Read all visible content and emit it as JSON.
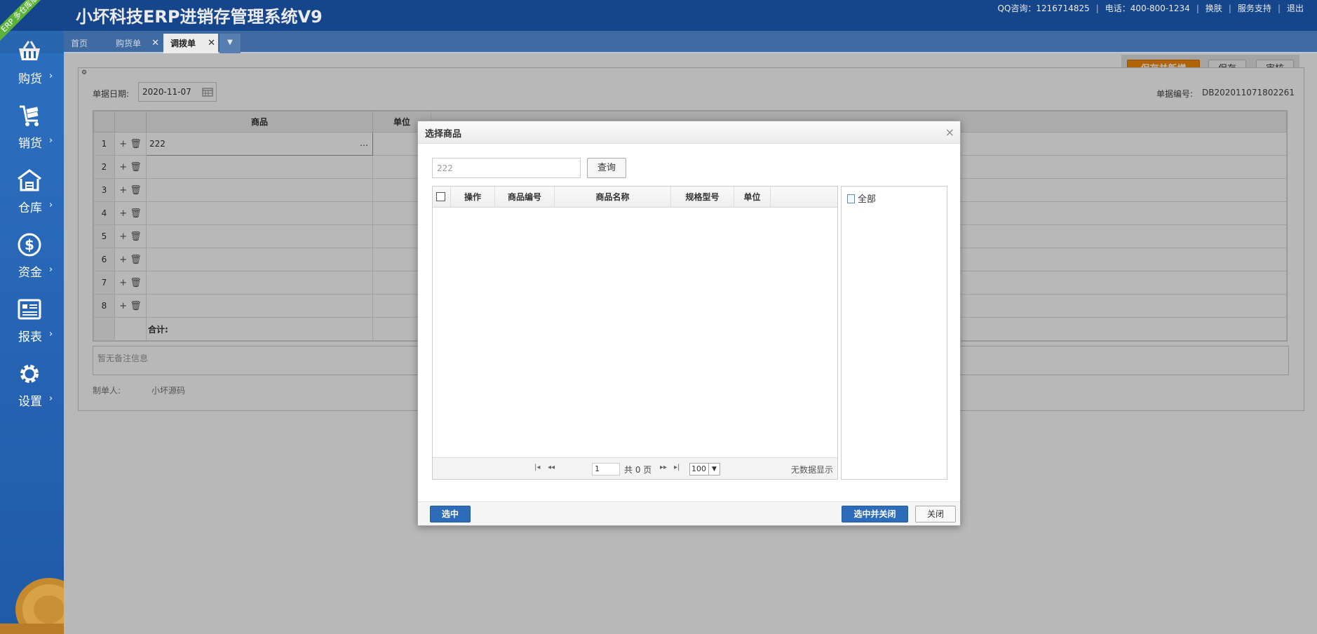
{
  "header": {
    "title": "小坏科技ERP进销存管理系统V9",
    "ribbon": "ERP 多仓库版",
    "links": [
      "QQ咨询：1216714825",
      "电话：400-800-1234",
      "换肤",
      "服务支持",
      "退出"
    ]
  },
  "sidebar": {
    "items": [
      {
        "label": "购货",
        "icon": "basket-icon"
      },
      {
        "label": "销货",
        "icon": "cart-icon"
      },
      {
        "label": "仓库",
        "icon": "warehouse-icon"
      },
      {
        "label": "资金",
        "icon": "dollar-icon"
      },
      {
        "label": "报表",
        "icon": "report-icon"
      },
      {
        "label": "设置",
        "icon": "gear-icon"
      }
    ]
  },
  "tabs": [
    {
      "label": "首页"
    },
    {
      "label": "购货单"
    },
    {
      "label": "调拨单"
    }
  ],
  "form": {
    "date_label": "单据日期:",
    "date_value": "2020-11-07",
    "doc_no_label": "单据编号:",
    "doc_no_value": "DB202011071802261",
    "btn_save_new": "保存并新增",
    "btn_save": "保存",
    "btn_audit": "审核",
    "col_product": "商品",
    "col_unit": "单位",
    "first_row_value": "222",
    "rows": [
      "1",
      "2",
      "3",
      "4",
      "5",
      "6",
      "7",
      "8"
    ],
    "total_label": "合计:",
    "memo_placeholder": "暂无备注信息",
    "maker_label": "制单人:",
    "maker_value": "小坏源码"
  },
  "dialog": {
    "title": "选择商品",
    "search_value": "222",
    "query_button": "查询",
    "columns": [
      "操作",
      "商品编号",
      "商品名称",
      "规格型号",
      "单位"
    ],
    "pager": {
      "page_value": "1",
      "total_text": "共 0 页",
      "page_size": "100",
      "empty_text": "无数据显示"
    },
    "tree_root": "全部",
    "btn_select": "选中",
    "btn_select_close": "选中并关闭",
    "btn_close": "关闭"
  },
  "colors": {
    "header_bg": "#174b97",
    "sidebar_bg": "#2563b2",
    "tabbar_bg": "#4675b0",
    "accent_orange": "#f58a0a",
    "button_blue": "#2d6cb9"
  }
}
